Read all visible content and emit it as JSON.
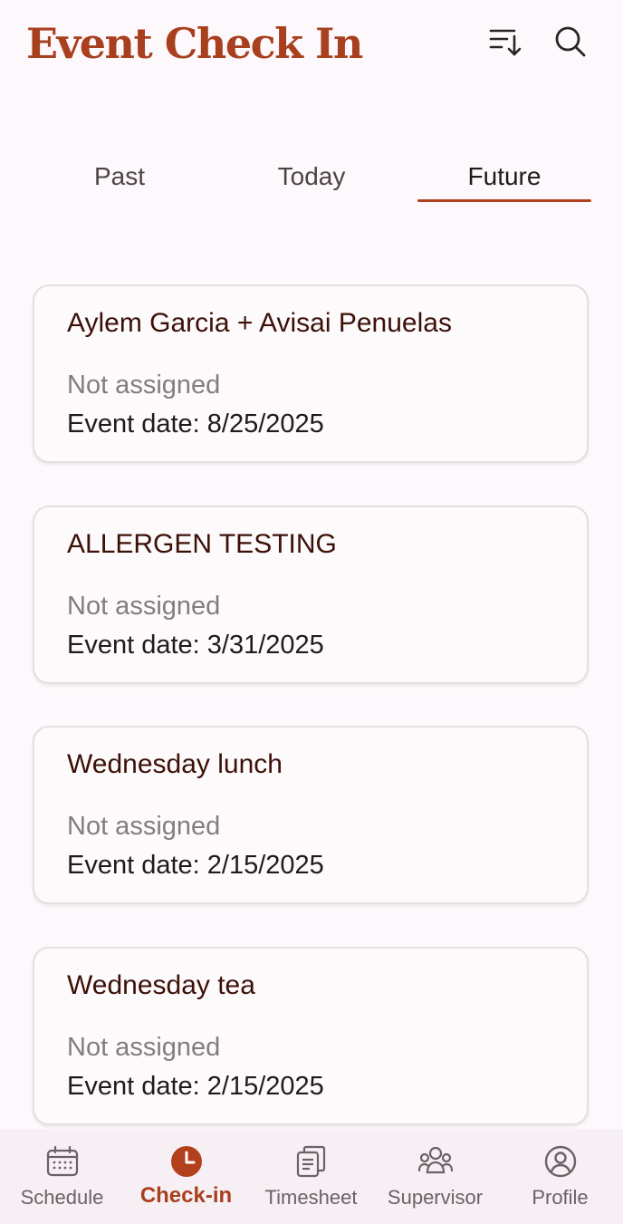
{
  "header": {
    "title": "Event Check In",
    "sort_icon": "sort-icon",
    "search_icon": "search-icon"
  },
  "tabs": [
    {
      "label": "Past",
      "active": false
    },
    {
      "label": "Today",
      "active": false
    },
    {
      "label": "Future",
      "active": true
    }
  ],
  "events": [
    {
      "title": "Aylem Garcia + Avisai Penuelas",
      "status": "Not assigned",
      "date": "Event date: 8/25/2025"
    },
    {
      "title": "ALLERGEN TESTING",
      "status": "Not assigned",
      "date": "Event date: 3/31/2025"
    },
    {
      "title": "Wednesday lunch",
      "status": "Not assigned",
      "date": "Event date: 2/15/2025"
    },
    {
      "title": "Wednesday tea",
      "status": "Not assigned",
      "date": "Event date: 2/15/2025"
    }
  ],
  "bottom_nav": [
    {
      "label": "Schedule",
      "icon": "calendar-icon",
      "active": false
    },
    {
      "label": "Check-in",
      "icon": "clock-icon",
      "active": true
    },
    {
      "label": "Timesheet",
      "icon": "clipboard-icon",
      "active": false
    },
    {
      "label": "Supervisor",
      "icon": "group-icon",
      "active": false
    },
    {
      "label": "Profile",
      "icon": "profile-icon",
      "active": false
    }
  ],
  "colors": {
    "brand": "#a8401f",
    "background": "#fdf8fb",
    "card_title": "#3c1007",
    "muted_text": "#857b80",
    "nav_background": "#f6eff3"
  }
}
